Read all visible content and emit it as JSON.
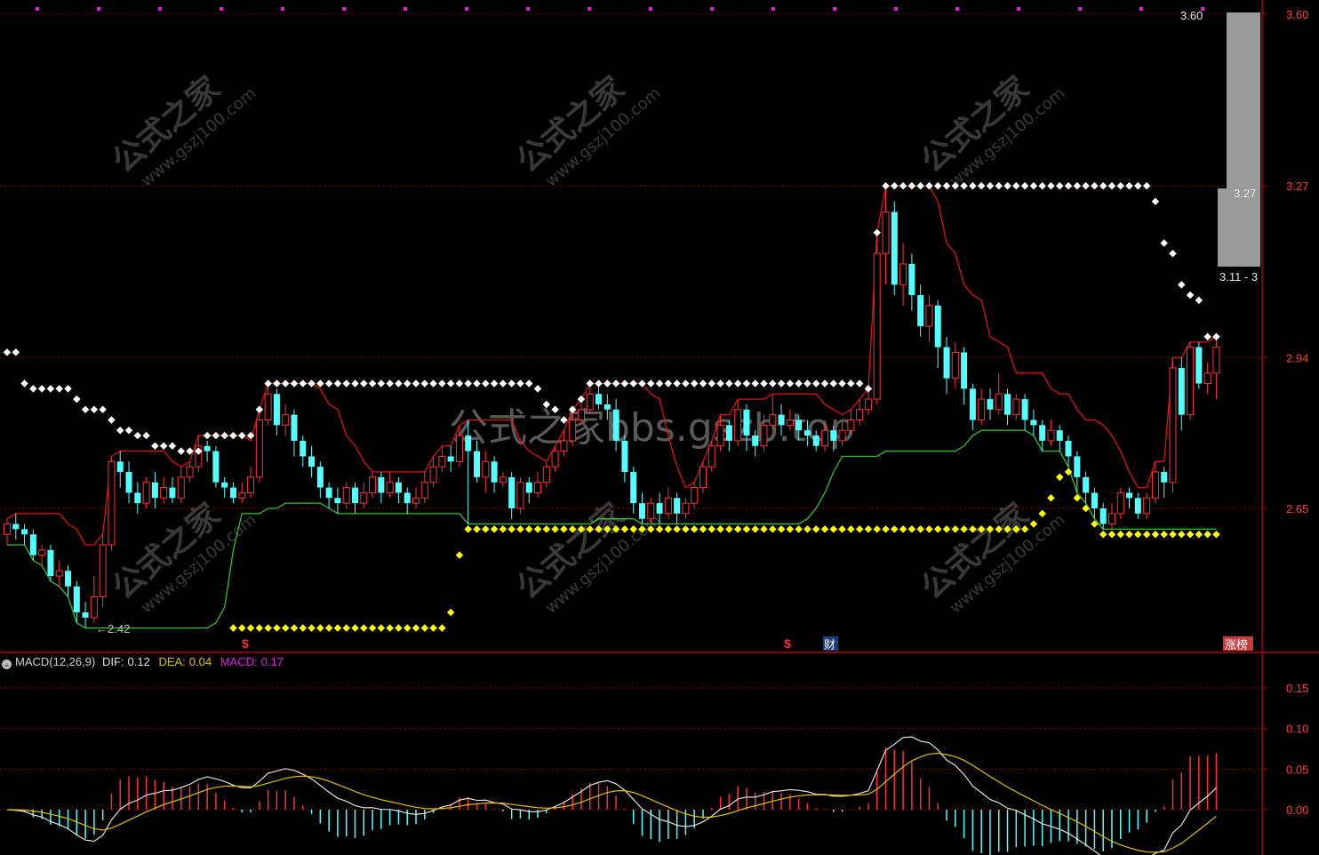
{
  "colors": {
    "up": "#ff3232",
    "down": "#54ffff",
    "grid": "#8b0000",
    "axis_text": "#ff3c3c",
    "resist_dots": "#ffffff",
    "support_dots": "#ffff00",
    "red_line": "#e01010",
    "green_line": "#30c030",
    "dif": "#e0e0e0",
    "dea": "#e0c000",
    "macd_pos": "#ff3232",
    "macd_neg": "#54ffff"
  },
  "watermark": {
    "center": "公式之家bbs.gszb.top",
    "tile_cn": "公式之家",
    "tile_url": "www.gszj100.com"
  },
  "markers": {
    "s_label": "$",
    "cai_label": "财",
    "zhangbang_label": "涨榜",
    "low_label": "←2.42"
  },
  "chart_data": [
    {
      "type": "candlestick",
      "y_axis_ticks": [
        "3.60",
        "3.27",
        "2.94",
        "2.65"
      ],
      "y_axis_values": [
        3.6,
        3.27,
        2.94,
        2.65
      ],
      "ylim": [
        2.3,
        3.62
      ],
      "price_labels": [
        "3.60",
        "3.27",
        "3.11 - 3"
      ],
      "low_label_value": 2.42,
      "candles": [
        [
          2.6,
          2.62,
          2.63,
          2.58
        ],
        [
          2.62,
          2.61,
          2.64,
          2.59
        ],
        [
          2.61,
          2.6,
          2.62,
          2.58
        ],
        [
          2.6,
          2.56,
          2.61,
          2.55
        ],
        [
          2.56,
          2.57,
          2.58,
          2.54
        ],
        [
          2.57,
          2.52,
          2.58,
          2.51
        ],
        [
          2.52,
          2.53,
          2.55,
          2.5
        ],
        [
          2.53,
          2.5,
          2.54,
          2.48
        ],
        [
          2.5,
          2.45,
          2.51,
          2.43
        ],
        [
          2.45,
          2.44,
          2.47,
          2.42
        ],
        [
          2.44,
          2.48,
          2.52,
          2.43
        ],
        [
          2.48,
          2.58,
          2.6,
          2.46
        ],
        [
          2.58,
          2.74,
          2.75,
          2.57
        ],
        [
          2.74,
          2.72,
          2.76,
          2.69
        ],
        [
          2.72,
          2.68,
          2.74,
          2.66
        ],
        [
          2.68,
          2.66,
          2.7,
          2.64
        ],
        [
          2.66,
          2.7,
          2.71,
          2.65
        ],
        [
          2.7,
          2.67,
          2.72,
          2.65
        ],
        [
          2.67,
          2.69,
          2.71,
          2.66
        ],
        [
          2.69,
          2.67,
          2.71,
          2.66
        ],
        [
          2.67,
          2.71,
          2.73,
          2.66
        ],
        [
          2.71,
          2.73,
          2.74,
          2.7
        ],
        [
          2.73,
          2.77,
          2.79,
          2.72
        ],
        [
          2.77,
          2.76,
          2.78,
          2.74
        ],
        [
          2.76,
          2.7,
          2.77,
          2.69
        ],
        [
          2.7,
          2.69,
          2.71,
          2.67
        ],
        [
          2.69,
          2.67,
          2.7,
          2.66
        ],
        [
          2.67,
          2.68,
          2.7,
          2.66
        ],
        [
          2.68,
          2.71,
          2.73,
          2.67
        ],
        [
          2.71,
          2.82,
          2.84,
          2.7
        ],
        [
          2.82,
          2.87,
          2.89,
          2.81
        ],
        [
          2.87,
          2.81,
          2.88,
          2.79
        ],
        [
          2.81,
          2.83,
          2.85,
          2.79
        ],
        [
          2.83,
          2.78,
          2.84,
          2.75
        ],
        [
          2.78,
          2.75,
          2.79,
          2.73
        ],
        [
          2.75,
          2.73,
          2.77,
          2.71
        ],
        [
          2.73,
          2.69,
          2.74,
          2.67
        ],
        [
          2.69,
          2.67,
          2.7,
          2.65
        ],
        [
          2.67,
          2.66,
          2.69,
          2.64
        ],
        [
          2.66,
          2.69,
          2.7,
          2.65
        ],
        [
          2.69,
          2.66,
          2.7,
          2.64
        ],
        [
          2.66,
          2.68,
          2.7,
          2.65
        ],
        [
          2.68,
          2.71,
          2.72,
          2.67
        ],
        [
          2.71,
          2.68,
          2.72,
          2.66
        ],
        [
          2.68,
          2.7,
          2.72,
          2.67
        ],
        [
          2.7,
          2.68,
          2.71,
          2.66
        ],
        [
          2.68,
          2.66,
          2.69,
          2.64
        ],
        [
          2.66,
          2.67,
          2.69,
          2.65
        ],
        [
          2.67,
          2.7,
          2.72,
          2.66
        ],
        [
          2.7,
          2.73,
          2.75,
          2.69
        ],
        [
          2.73,
          2.75,
          2.77,
          2.72
        ],
        [
          2.75,
          2.74,
          2.77,
          2.72
        ],
        [
          2.74,
          2.79,
          2.81,
          2.73
        ],
        [
          2.79,
          2.76,
          2.82,
          2.62
        ],
        [
          2.76,
          2.71,
          2.78,
          2.7
        ],
        [
          2.71,
          2.74,
          2.76,
          2.68
        ],
        [
          2.74,
          2.7,
          2.75,
          2.68
        ],
        [
          2.7,
          2.71,
          2.72,
          2.69
        ],
        [
          2.71,
          2.65,
          2.72,
          2.63
        ],
        [
          2.65,
          2.7,
          2.71,
          2.64
        ],
        [
          2.7,
          2.68,
          2.71,
          2.66
        ],
        [
          2.68,
          2.7,
          2.72,
          2.67
        ],
        [
          2.7,
          2.73,
          2.74,
          2.69
        ],
        [
          2.73,
          2.76,
          2.77,
          2.72
        ],
        [
          2.76,
          2.78,
          2.8,
          2.75
        ],
        [
          2.78,
          2.82,
          2.84,
          2.77
        ],
        [
          2.82,
          2.84,
          2.86,
          2.81
        ],
        [
          2.84,
          2.87,
          2.89,
          2.83
        ],
        [
          2.87,
          2.85,
          2.89,
          2.84
        ],
        [
          2.85,
          2.84,
          2.87,
          2.82
        ],
        [
          2.84,
          2.78,
          2.86,
          2.76
        ],
        [
          2.78,
          2.72,
          2.79,
          2.7
        ],
        [
          2.72,
          2.66,
          2.73,
          2.64
        ],
        [
          2.66,
          2.63,
          2.68,
          2.62
        ],
        [
          2.63,
          2.66,
          2.67,
          2.62
        ],
        [
          2.66,
          2.64,
          2.68,
          2.62
        ],
        [
          2.64,
          2.67,
          2.69,
          2.63
        ],
        [
          2.67,
          2.64,
          2.68,
          2.62
        ],
        [
          2.64,
          2.66,
          2.67,
          2.63
        ],
        [
          2.66,
          2.69,
          2.7,
          2.65
        ],
        [
          2.69,
          2.73,
          2.74,
          2.68
        ],
        [
          2.73,
          2.77,
          2.78,
          2.72
        ],
        [
          2.77,
          2.81,
          2.83,
          2.76
        ],
        [
          2.81,
          2.78,
          2.82,
          2.76
        ],
        [
          2.78,
          2.84,
          2.86,
          2.77
        ],
        [
          2.84,
          2.79,
          2.85,
          2.76
        ],
        [
          2.79,
          2.77,
          2.8,
          2.75
        ],
        [
          2.77,
          2.81,
          2.83,
          2.76
        ],
        [
          2.81,
          2.83,
          2.87,
          2.8
        ],
        [
          2.83,
          2.81,
          2.85,
          2.79
        ],
        [
          2.81,
          2.82,
          2.84,
          2.8
        ],
        [
          2.82,
          2.8,
          2.83,
          2.78
        ],
        [
          2.8,
          2.79,
          2.82,
          2.77
        ],
        [
          2.79,
          2.77,
          2.8,
          2.76
        ],
        [
          2.77,
          2.8,
          2.82,
          2.76
        ],
        [
          2.8,
          2.78,
          2.81,
          2.76
        ],
        [
          2.78,
          2.8,
          2.82,
          2.77
        ],
        [
          2.8,
          2.82,
          2.84,
          2.79
        ],
        [
          2.82,
          2.84,
          2.86,
          2.81
        ],
        [
          2.84,
          2.86,
          2.88,
          2.83
        ],
        [
          2.86,
          3.14,
          3.18,
          2.85
        ],
        [
          3.14,
          3.22,
          3.27,
          3.08
        ],
        [
          3.22,
          3.08,
          3.24,
          3.06
        ],
        [
          3.08,
          3.12,
          3.16,
          3.04
        ],
        [
          3.12,
          3.06,
          3.14,
          3.03
        ],
        [
          3.06,
          3.0,
          3.08,
          2.98
        ],
        [
          3.0,
          3.04,
          3.06,
          2.97
        ],
        [
          3.04,
          2.96,
          3.05,
          2.92
        ],
        [
          2.96,
          2.9,
          2.98,
          2.87
        ],
        [
          2.9,
          2.95,
          2.97,
          2.88
        ],
        [
          2.95,
          2.88,
          2.96,
          2.85
        ],
        [
          2.88,
          2.82,
          2.89,
          2.8
        ],
        [
          2.82,
          2.86,
          2.88,
          2.81
        ],
        [
          2.86,
          2.84,
          2.88,
          2.82
        ],
        [
          2.84,
          2.87,
          2.91,
          2.83
        ],
        [
          2.87,
          2.83,
          2.88,
          2.81
        ],
        [
          2.83,
          2.86,
          2.87,
          2.82
        ],
        [
          2.86,
          2.82,
          2.87,
          2.8
        ],
        [
          2.82,
          2.81,
          2.84,
          2.79
        ],
        [
          2.81,
          2.78,
          2.82,
          2.76
        ],
        [
          2.78,
          2.8,
          2.82,
          2.77
        ],
        [
          2.8,
          2.78,
          2.81,
          2.76
        ],
        [
          2.78,
          2.75,
          2.79,
          2.73
        ],
        [
          2.75,
          2.71,
          2.76,
          2.68
        ],
        [
          2.71,
          2.68,
          2.72,
          2.66
        ],
        [
          2.68,
          2.65,
          2.69,
          2.63
        ],
        [
          2.65,
          2.62,
          2.66,
          2.61
        ],
        [
          2.62,
          2.64,
          2.66,
          2.61
        ],
        [
          2.64,
          2.68,
          2.69,
          2.63
        ],
        [
          2.68,
          2.67,
          2.69,
          2.65
        ],
        [
          2.67,
          2.64,
          2.68,
          2.63
        ],
        [
          2.64,
          2.67,
          2.68,
          2.63
        ],
        [
          2.67,
          2.72,
          2.74,
          2.66
        ],
        [
          2.72,
          2.7,
          2.73,
          2.67
        ],
        [
          2.7,
          2.92,
          2.94,
          2.68
        ],
        [
          2.92,
          2.83,
          2.94,
          2.8
        ],
        [
          2.83,
          2.96,
          2.97,
          2.82
        ],
        [
          2.96,
          2.89,
          2.97,
          2.88
        ],
        [
          2.89,
          2.91,
          2.93,
          2.87
        ],
        [
          2.91,
          2.96,
          2.98,
          2.86
        ]
      ],
      "resist_dots": [
        [
          0,
          2.95
        ],
        [
          1,
          2.95
        ],
        [
          2,
          2.89
        ],
        [
          3,
          2.88
        ],
        [
          4,
          2.88
        ],
        [
          5,
          2.88
        ],
        [
          6,
          2.88
        ],
        [
          7,
          2.88
        ],
        [
          8,
          2.86
        ],
        [
          9,
          2.84
        ],
        [
          10,
          2.84
        ],
        [
          11,
          2.84
        ],
        [
          12,
          2.82
        ],
        [
          13,
          2.8
        ],
        [
          14,
          2.8
        ],
        [
          15,
          2.79
        ],
        [
          16,
          2.79
        ],
        [
          17,
          2.77
        ],
        [
          18,
          2.77
        ],
        [
          19,
          2.77
        ],
        [
          20,
          2.76
        ],
        [
          21,
          2.76
        ],
        [
          22,
          2.76
        ]
      ],
      "macd_header": {
        "name": "MACD(12,26,9)",
        "dif_label": "DIF:",
        "dif_value": "0.12",
        "dea_label": "DEA:",
        "dea_value": "0.04",
        "macd_label": "MACD:",
        "macd_value": "0.17"
      },
      "macd_ticks": [
        "0.15",
        "0.10",
        "0.05",
        "0.00"
      ],
      "macd_tick_values": [
        0.15,
        0.1,
        0.05,
        0.0
      ]
    }
  ]
}
